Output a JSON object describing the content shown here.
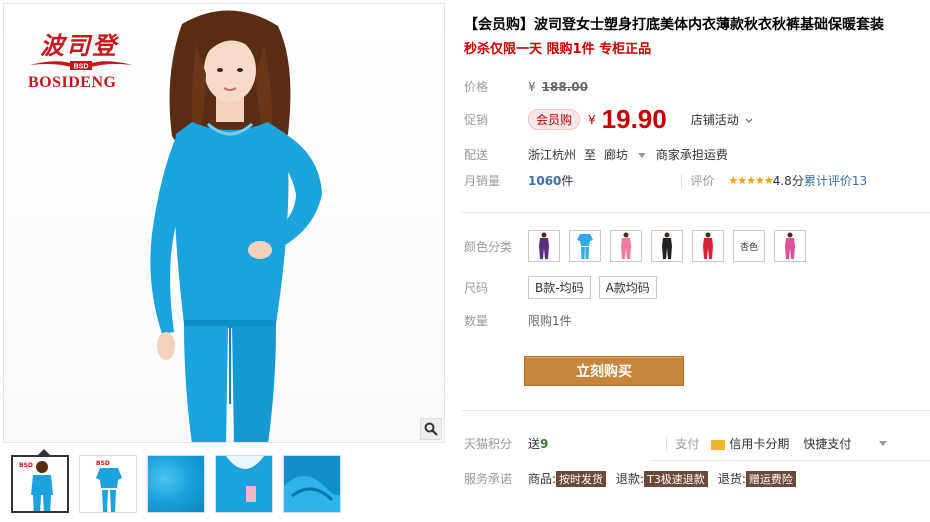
{
  "gallery": {
    "brand_cn": "波司登",
    "brand_en": "BOSIDENG",
    "thumbnail_count": 5,
    "active_thumbnail": 1
  },
  "product": {
    "title": "【会员购】波司登女士塑身打底美体内衣薄款秋衣秋裤基础保暖套装",
    "subtitle": "秒杀仅限一天 限购1件 专柜正品"
  },
  "price": {
    "label": "价格",
    "currency": "¥",
    "original": "188.00"
  },
  "promo": {
    "label": "促销",
    "badge": "会员购",
    "currency": "¥",
    "price": "19.90",
    "shop_activity": "店铺活动"
  },
  "shipping": {
    "label": "配送",
    "from": "浙江杭州",
    "to_word": "至",
    "to": "廊坊",
    "fee": "商家承担运费"
  },
  "sales": {
    "label": "月销量",
    "count": "1060",
    "unit": "件",
    "rating_label": "评价",
    "stars": "★★★★★",
    "score": "4.8分",
    "reviews_label": "累计评价",
    "reviews_count": "13"
  },
  "options": {
    "color_label": "颜色分类",
    "colors": [
      {
        "name": "purple",
        "hex": "#5a2c7a"
      },
      {
        "name": "skyblue",
        "hex": "#2fa9e6"
      },
      {
        "name": "pink",
        "hex": "#f07aa0"
      },
      {
        "name": "black",
        "hex": "#222222"
      },
      {
        "name": "red",
        "hex": "#d8203a"
      },
      {
        "name": "text",
        "label": "杏色"
      },
      {
        "name": "rose",
        "hex": "#e0509a"
      }
    ],
    "size_label": "尺码",
    "sizes": [
      "B款-均码",
      "A款均码"
    ],
    "qty_label": "数量",
    "qty_note": "限购1件"
  },
  "buy_button": "立刻购买",
  "points": {
    "label": "天猫积分",
    "send_word": "送",
    "value": "9",
    "pay_label": "支付",
    "card_installment": "信用卡分期",
    "quick_pay": "快捷支付"
  },
  "service": {
    "label": "服务承诺",
    "items": [
      {
        "prefix": "商品:",
        "tag": "按时发货"
      },
      {
        "prefix": "退款:",
        "tag": "T3极速退款"
      },
      {
        "prefix": "退货:",
        "tag": "赠运费险"
      }
    ]
  },
  "colors": {
    "accent_red": "#c40000",
    "buy_button": "#c8863c",
    "garment_blue": "#1aa3dc"
  }
}
